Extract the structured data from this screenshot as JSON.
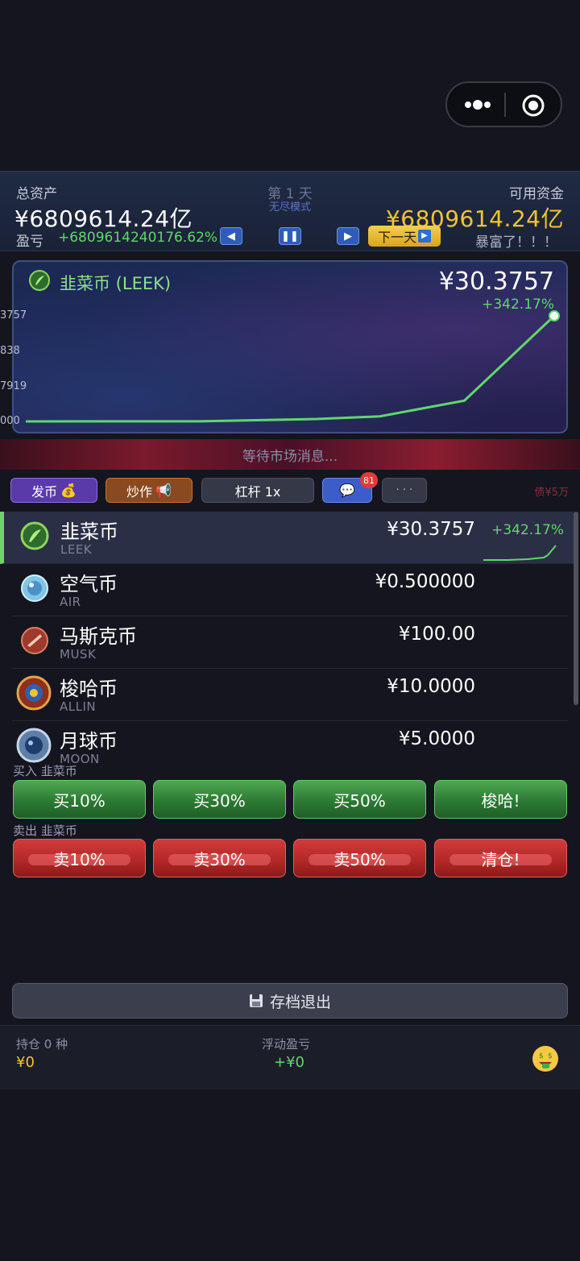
{
  "capsule": {
    "more_icon": "more-dots-icon",
    "close_icon": "target-circle-icon"
  },
  "header": {
    "total_assets_label": "总资产",
    "total_assets_value": "¥6809614.24亿",
    "pnl_label": "盈亏",
    "pnl_value": "+6809614240176.62%",
    "day_label": "第 1 天",
    "mode_label": "无尽模式",
    "available_label": "可用资金",
    "available_value": "¥6809614.24亿",
    "next_day_label": "下一天",
    "status_text": "暴富了！！！",
    "controls": [
      "prev",
      "pause",
      "play"
    ]
  },
  "chart": {
    "coin_title": "韭菜币 (LEEK)",
    "price": "¥30.3757",
    "change": "+342.17%",
    "line_color": "#5fd86a"
  },
  "chart_data": {
    "type": "line",
    "title": "韭菜币 (LEEK)",
    "ytick_labels": [
      "3757",
      "838",
      "7919",
      "000"
    ],
    "x": [
      0,
      1,
      2,
      3,
      4,
      5
    ],
    "series": [
      {
        "values": [
          6.87,
          6.9,
          7.4,
          8.0,
          11.5,
          30.3757
        ]
      }
    ],
    "grid": false
  },
  "banner": {
    "text": "等待市场消息..."
  },
  "actions": {
    "issue_label": "发币",
    "hype_label": "炒作",
    "leverage_label": "杠杆 1x",
    "chat_badge": "81",
    "more_label": "· · ·",
    "debt_label": "债¥5万"
  },
  "coins": [
    {
      "name": "韭菜币",
      "symbol": "LEEK",
      "price": "¥30.3757",
      "change": "+342.17%",
      "active": true
    },
    {
      "name": "空气币",
      "symbol": "AIR",
      "price": "¥0.500000"
    },
    {
      "name": "马斯克币",
      "symbol": "MUSK",
      "price": "¥100.00"
    },
    {
      "name": "梭哈币",
      "symbol": "ALLIN",
      "price": "¥10.0000"
    },
    {
      "name": "月球币",
      "symbol": "MOON",
      "price": "¥5.0000"
    }
  ],
  "trade": {
    "buy_label": "买入 韭菜币",
    "sell_label": "卖出 韭菜币",
    "buy_buttons": [
      "买10%",
      "买30%",
      "买50%",
      "梭哈!"
    ],
    "sell_buttons": [
      "卖10%",
      "卖30%",
      "卖50%",
      "清仓!"
    ]
  },
  "save_button": "存档退出",
  "footer": {
    "holdings_label": "持仓 0 种",
    "holdings_value": "¥0",
    "float_label": "浮动盈亏",
    "float_value": "+¥0"
  },
  "colors": {
    "accent_gold": "#f3c331",
    "up_green": "#5fd86a",
    "buy_green": "#2c7a33",
    "sell_red": "#b42828"
  }
}
